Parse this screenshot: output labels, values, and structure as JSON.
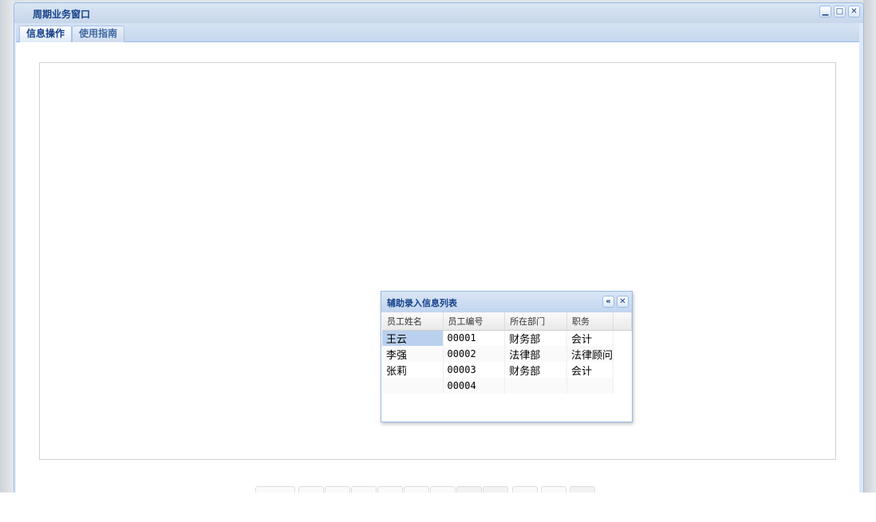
{
  "window": {
    "title": "周期业务窗口",
    "tools": [
      "minimize-icon",
      "maximize-icon",
      "close-icon"
    ]
  },
  "tabs": [
    {
      "label": "信息操作",
      "active": true
    },
    {
      "label": "使用指南",
      "active": false
    }
  ],
  "popup": {
    "title": "辅助录入信息列表",
    "columns": [
      "员工姓名",
      "员工编号",
      "所在部门",
      "职务"
    ],
    "rows": [
      [
        "王云",
        "00001",
        "财务部",
        "会计"
      ],
      [
        "李强",
        "00002",
        "法律部",
        "法律顾问"
      ],
      [
        "张莉",
        "00003",
        "财务部",
        "会计"
      ],
      [
        "",
        "00004",
        "",
        ""
      ]
    ]
  }
}
